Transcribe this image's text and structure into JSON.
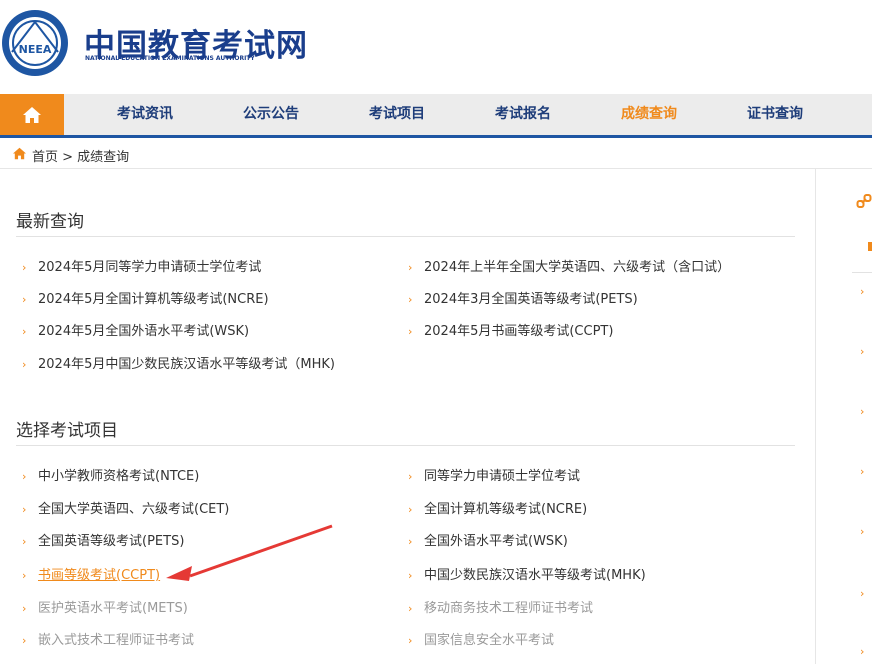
{
  "header": {
    "title": "中国教育考试网",
    "subtitle": "NATIONAL EDUCATION EXAMINATIONS AUTHORITY",
    "logo_text": "NEEA"
  },
  "nav": {
    "items": [
      {
        "label": "考试资讯"
      },
      {
        "label": "公示公告"
      },
      {
        "label": "考试项目"
      },
      {
        "label": "考试报名"
      },
      {
        "label": "成绩查询"
      },
      {
        "label": "证书查询"
      }
    ],
    "active": "成绩查询"
  },
  "breadcrumb": {
    "text": "首页 > 成绩查询"
  },
  "latest": {
    "title": "最新查询",
    "items": [
      "2024年5月同等学力申请硕士学位考试",
      "2024年上半年全国大学英语四、六级考试（含口试）",
      "2024年5月全国计算机等级考试(NCRE)",
      "2024年3月全国英语等级考试(PETS)",
      "2024年5月全国外语水平考试(WSK)",
      "2024年5月书画等级考试(CCPT)",
      "2024年5月中国少数民族汉语水平等级考试（MHK)"
    ]
  },
  "projects": {
    "title": "选择考试项目",
    "items": [
      "中小学教师资格考试(NTCE)",
      "同等学力申请硕士学位考试",
      "全国大学英语四、六级考试(CET)",
      "全国计算机等级考试(NCRE)",
      "全国英语等级考试(PETS)",
      "全国外语水平考试(WSK)",
      "书画等级考试(CCPT)",
      "中国少数民族汉语水平等级考试(MHK)",
      "医护英语水平考试(METS)",
      "移动商务技术工程师证书考试",
      "嵌入式技术工程师证书考试",
      "国家信息安全水平考试"
    ]
  },
  "colors": {
    "accent": "#f08a1c",
    "nav_text": "#1e3d7a",
    "nav_bar": "#1e56a3",
    "annotation_arrow": "#e53935"
  },
  "icons": [
    "home-icon",
    "link-icon",
    "arrow-annotation"
  ]
}
